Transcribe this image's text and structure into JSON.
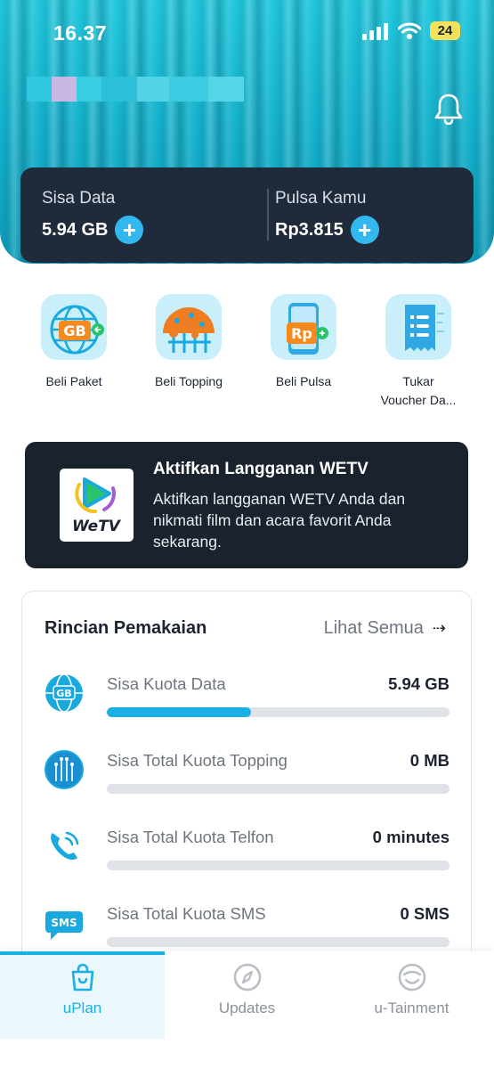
{
  "status_bar": {
    "time": "16.37",
    "battery": "24"
  },
  "header": {
    "username_redacted": true
  },
  "balance": {
    "data_label": "Sisa Data",
    "data_value": "5.94 GB",
    "credit_label": "Pulsa Kamu",
    "credit_value": "Rp3.815"
  },
  "actions": [
    {
      "label": "Beli Paket",
      "icon": "gb-globe-icon"
    },
    {
      "label": "Beli Topping",
      "icon": "topping-icon"
    },
    {
      "label": "Beli Pulsa",
      "icon": "rp-phone-icon"
    },
    {
      "label": "Tukar\nVoucher Da...",
      "icon": "voucher-icon"
    }
  ],
  "promo": {
    "title": "Aktifkan Langganan WETV",
    "description": "Aktifkan langganan WETV Anda dan nikmati film dan acara favorit Anda sekarang.",
    "logo_text": "WeTV"
  },
  "usage": {
    "title": "Rincian Pemakaian",
    "see_all": "Lihat Semua",
    "rows": [
      {
        "label": "Sisa Kuota Data",
        "value": "5.94 GB",
        "fill": 0.42,
        "icon": "gb-globe-icon"
      },
      {
        "label": "Sisa Total Kuota Topping",
        "value": "0 MB",
        "fill": 0,
        "icon": "topping-globe-icon"
      },
      {
        "label": "Sisa Total Kuota Telfon",
        "value": "0 minutes",
        "fill": 0,
        "icon": "phone-call-icon"
      },
      {
        "label": "Sisa Total Kuota SMS",
        "value": "0 SMS",
        "fill": 0,
        "icon": "sms-bubble-icon"
      }
    ]
  },
  "nav": [
    {
      "label": "uPlan",
      "icon": "shopping-bag-icon",
      "active": true
    },
    {
      "label": "Updates",
      "icon": "compass-icon",
      "active": false
    },
    {
      "label": "u-Tainment",
      "icon": "smiley-icon",
      "active": false
    }
  ],
  "colors": {
    "accent": "#1ab0e6",
    "card_dark": "#1f2a3a",
    "promo_dark": "#1a222d"
  }
}
